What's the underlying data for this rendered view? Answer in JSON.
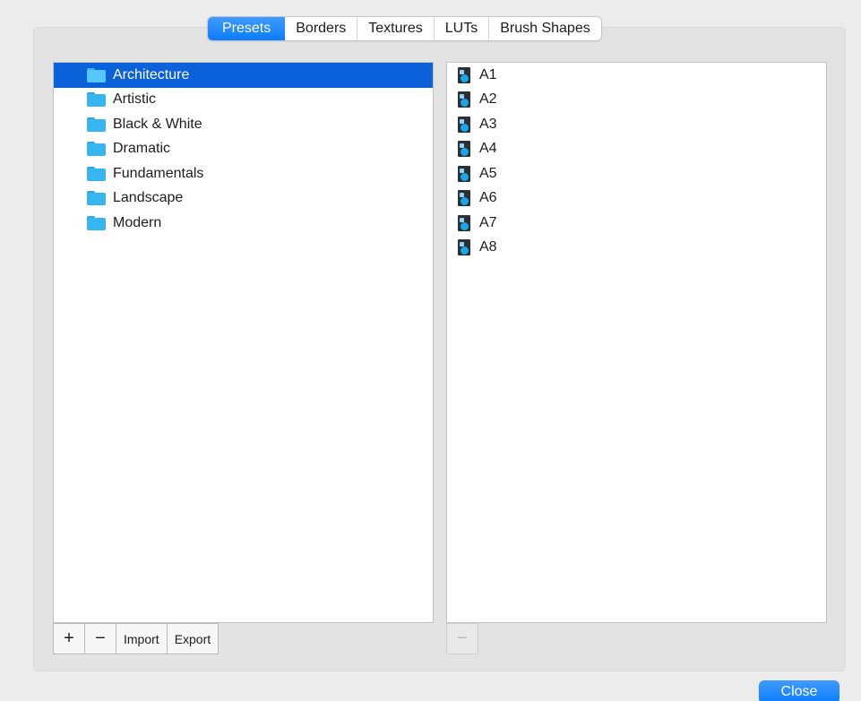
{
  "tabs": [
    {
      "label": "Presets",
      "active": true
    },
    {
      "label": "Borders",
      "active": false
    },
    {
      "label": "Textures",
      "active": false
    },
    {
      "label": "LUTs",
      "active": false
    },
    {
      "label": "Brush Shapes",
      "active": false
    }
  ],
  "folders": {
    "icon": "folder-icon",
    "items": [
      {
        "label": "Architecture",
        "selected": true
      },
      {
        "label": "Artistic",
        "selected": false
      },
      {
        "label": "Black & White",
        "selected": false
      },
      {
        "label": "Dramatic",
        "selected": false
      },
      {
        "label": "Fundamentals",
        "selected": false
      },
      {
        "label": "Landscape",
        "selected": false
      },
      {
        "label": "Modern",
        "selected": false
      }
    ]
  },
  "presets": {
    "icon": "preset-file-icon",
    "items": [
      {
        "label": "A1"
      },
      {
        "label": "A2"
      },
      {
        "label": "A3"
      },
      {
        "label": "A4"
      },
      {
        "label": "A5"
      },
      {
        "label": "A6"
      },
      {
        "label": "A7"
      },
      {
        "label": "A8"
      }
    ]
  },
  "left_toolbar": {
    "add_label": "+",
    "remove_label": "−",
    "import_label": "Import",
    "export_label": "Export"
  },
  "right_toolbar": {
    "remove_label": "−",
    "remove_disabled": true
  },
  "footer": {
    "close_label": "Close"
  },
  "colors": {
    "accent": "#0a7cff",
    "selection": "#0a61d9",
    "folder": "#36b5f0"
  }
}
